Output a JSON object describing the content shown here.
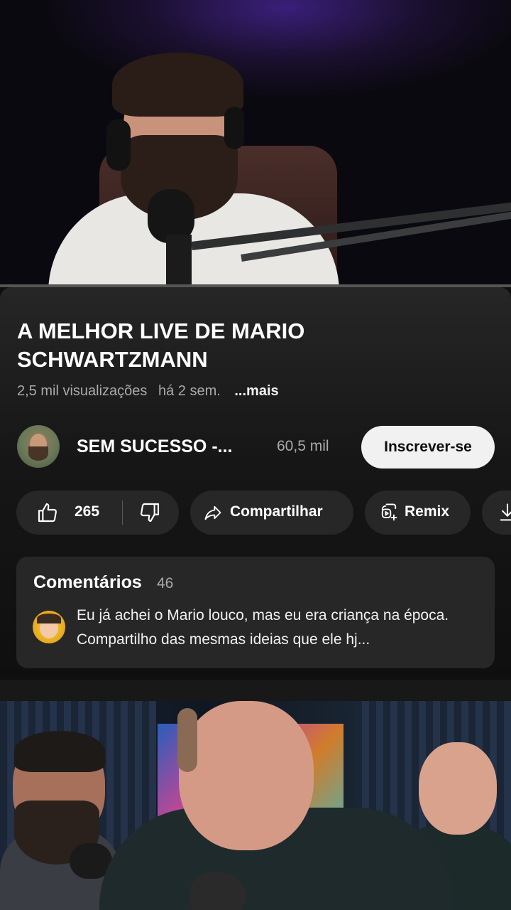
{
  "video": {
    "title": "A MELHOR LIVE DE MARIO SCHWARTZMANN",
    "views": "2,5 mil visualizações",
    "age": "há 2 sem.",
    "more_label": "...mais"
  },
  "channel": {
    "name": "SEM SUCESSO -...",
    "subscribers": "60,5 mil",
    "subscribe_label": "Inscrever-se"
  },
  "actions": {
    "likes": "265",
    "share_label": "Compartilhar",
    "remix_label": "Remix"
  },
  "comments": {
    "title": "Comentários",
    "count": "46",
    "top_comment": "Eu já achei o Mario louco, mas eu era criança na época. Compartilho das mesmas ideias que ele hj..."
  },
  "colors": {
    "background": "#0f0f0f",
    "pill": "#272727",
    "subscribe_bg": "#f1f1f1",
    "secondary_text": "#aaaaaa"
  },
  "icons": [
    "like-icon",
    "dislike-icon",
    "share-icon",
    "remix-icon",
    "download-icon"
  ]
}
